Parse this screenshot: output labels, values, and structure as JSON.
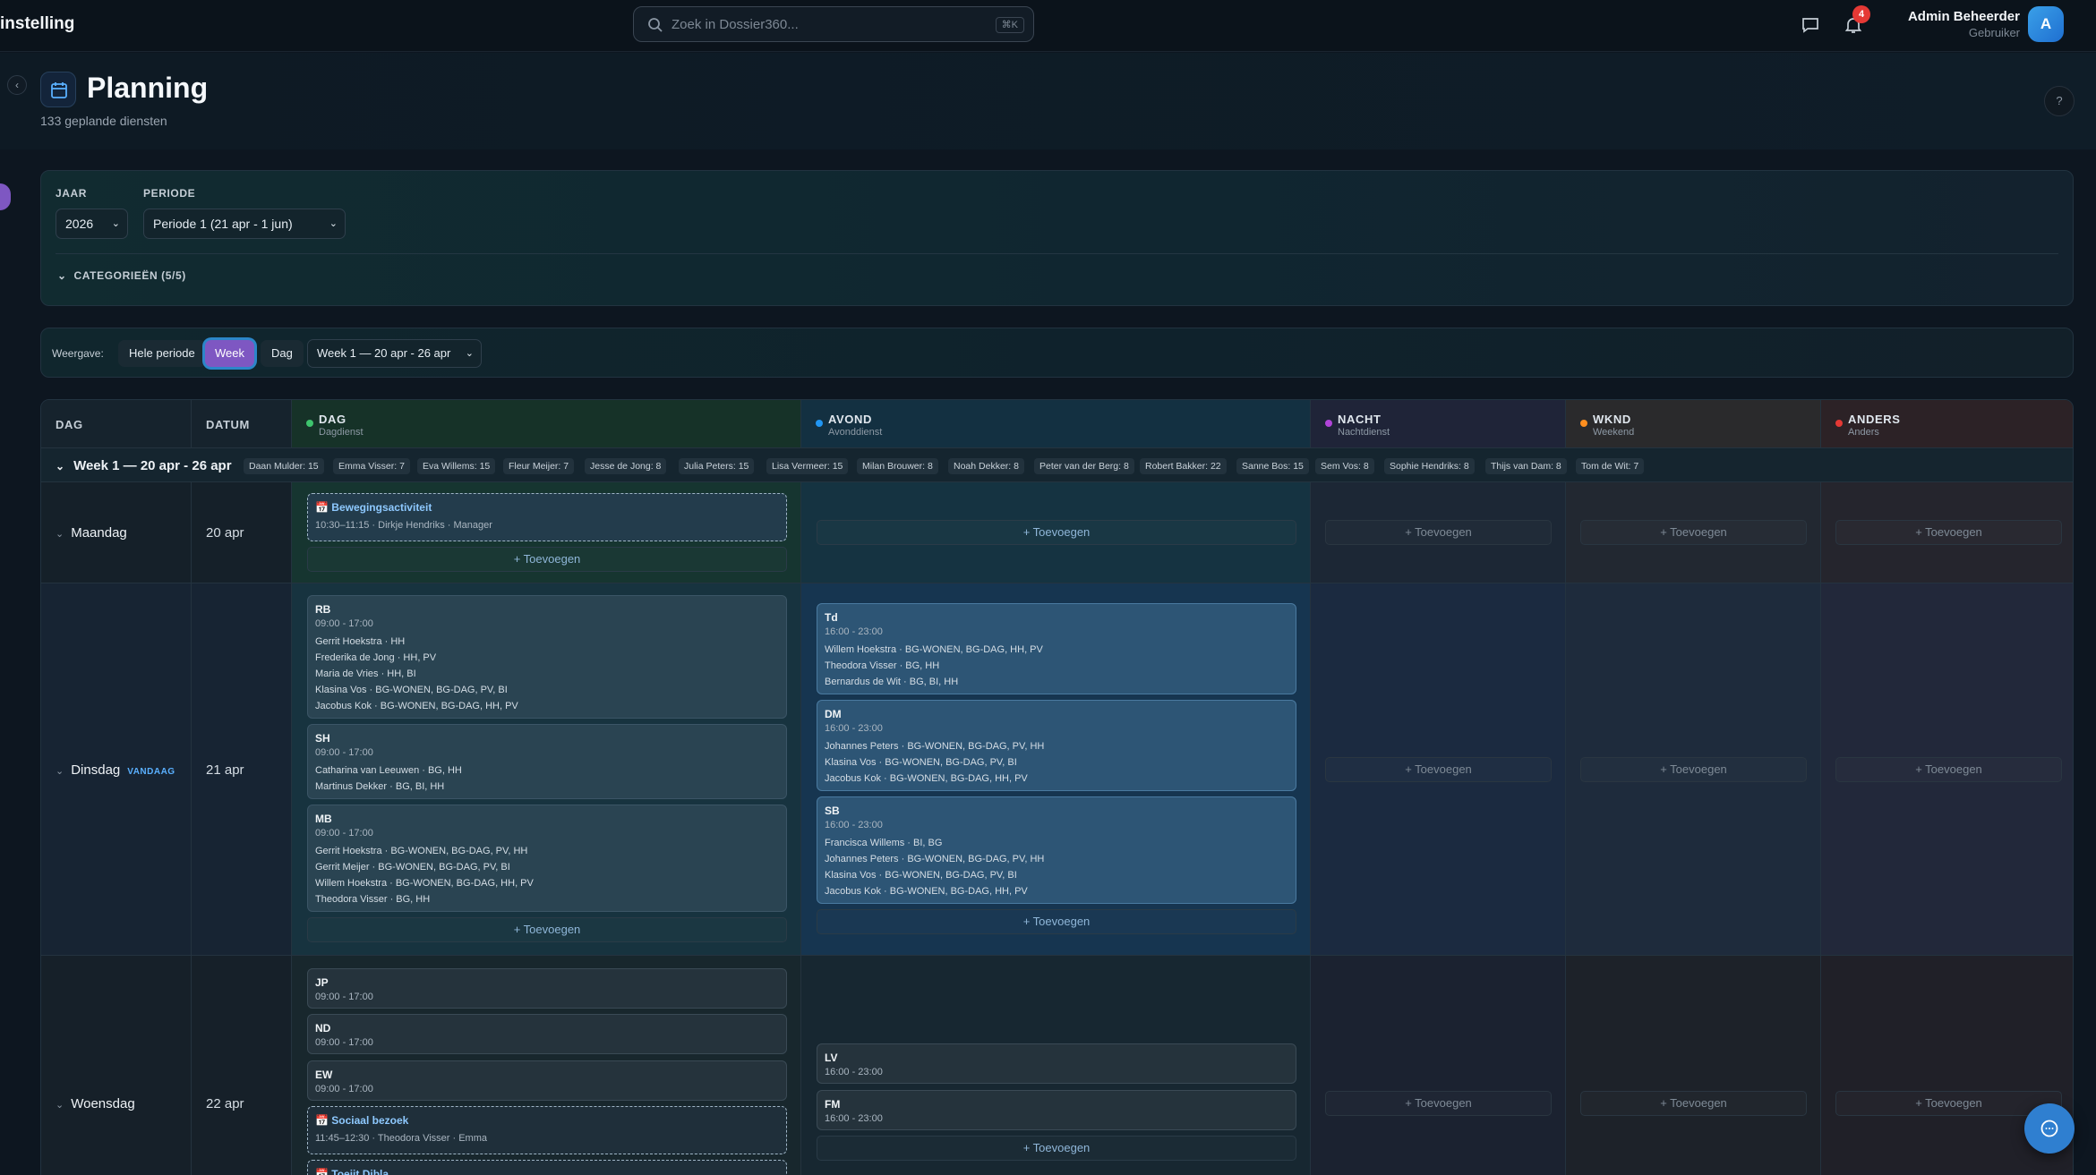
{
  "topbar": {
    "brand": "instelling",
    "search_placeholder": "Zoek in Dossier360...",
    "search_shortcut": "⌘K",
    "notification_count": "4",
    "user_name": "Admin Beheerder",
    "user_role": "Gebruiker",
    "avatar_initial": "A"
  },
  "header": {
    "title": "Planning",
    "subtitle": "133 geplande diensten",
    "help": "?"
  },
  "filters": {
    "year_label": "JAAR",
    "year_value": "2026",
    "period_label": "PERIODE",
    "period_value": "Periode 1 (21 apr - 1 jun)",
    "categories_label": "CATEGORIEËN (5/5)"
  },
  "view": {
    "label": "Weergave:",
    "options": [
      "Hele periode",
      "Week",
      "Dag"
    ],
    "active": "Week",
    "week_select": "Week 1 — 20 apr - 26 apr"
  },
  "grid": {
    "col_day": "DAG",
    "col_date": "DATUM",
    "shift_columns": [
      {
        "title": "DAG",
        "subtitle": "Dagdienst",
        "color": "#3ec46d"
      },
      {
        "title": "AVOND",
        "subtitle": "Avonddienst",
        "color": "#2196f3"
      },
      {
        "title": "NACHT",
        "subtitle": "Nachtdienst",
        "color": "#b044d8"
      },
      {
        "title": "WKND",
        "subtitle": "Weekend",
        "color": "#ff8f1f"
      },
      {
        "title": "ANDERS",
        "subtitle": "Anders",
        "color": "#e53935"
      }
    ],
    "week_title": "Week 1 — 20 apr - 26 apr",
    "chips": [
      "Daan Mulder: 15",
      "Emma Visser: 7",
      "Eva Willems: 15",
      "Fleur Meijer: 7",
      "Jesse de Jong: 8",
      "Julia Peters: 15",
      "Lisa Vermeer: 15",
      "Milan Brouwer: 8",
      "Noah Dekker: 8",
      "Peter van der Berg: 8",
      "Robert Bakker: 22",
      "Sanne Bos: 15",
      "Sem Vos: 8",
      "Sophie Hendriks: 8",
      "Thijs van Dam: 8",
      "Tom de Wit: 7"
    ],
    "add_label": "+ Toevoegen",
    "today_label": "VANDAAG",
    "days": [
      {
        "name": "Maandag",
        "date": "20 apr"
      },
      {
        "name": "Dinsdag",
        "date": "21 apr"
      },
      {
        "name": "Woensdag",
        "date": "22 apr"
      }
    ],
    "maandag_dag": {
      "activity": "Bewegingsactiviteit",
      "detail": "10:30–11:15 · Dirkje Hendriks · Manager"
    },
    "dinsdag_dag": [
      {
        "code": "RB",
        "time": "09:00 - 17:00",
        "people": [
          "Gerrit Hoekstra · HH",
          "Frederika de Jong · HH, PV",
          "Maria de Vries · HH, BI",
          "Klasina Vos · BG-WONEN, BG-DAG, PV, BI",
          "Jacobus Kok · BG-WONEN, BG-DAG, HH, PV"
        ]
      },
      {
        "code": "SH",
        "time": "09:00 - 17:00",
        "people": [
          "Catharina van Leeuwen · BG, HH",
          "Martinus Dekker · BG, BI, HH"
        ]
      },
      {
        "code": "MB",
        "time": "09:00 - 17:00",
        "people": [
          "Gerrit Hoekstra · BG-WONEN, BG-DAG, PV, HH",
          "Gerrit Meijer · BG-WONEN, BG-DAG, PV, BI",
          "Willem Hoekstra · BG-WONEN, BG-DAG, HH, PV",
          "Theodora Visser · BG, HH"
        ]
      }
    ],
    "dinsdag_avond": [
      {
        "code": "Td",
        "time": "16:00 - 23:00",
        "people": [
          "Willem Hoekstra · BG-WONEN, BG-DAG, HH, PV",
          "Theodora Visser · BG, HH",
          "Bernardus de Wit · BG, BI, HH"
        ]
      },
      {
        "code": "DM",
        "time": "16:00 - 23:00",
        "people": [
          "Johannes Peters · BG-WONEN, BG-DAG, PV, HH",
          "Klasina Vos · BG-WONEN, BG-DAG, PV, BI",
          "Jacobus Kok · BG-WONEN, BG-DAG, HH, PV"
        ]
      },
      {
        "code": "SB",
        "time": "16:00 - 23:00",
        "people": [
          "Francisca Willems · BI, BG",
          "Johannes Peters · BG-WONEN, BG-DAG, PV, HH",
          "Klasina Vos · BG-WONEN, BG-DAG, PV, BI",
          "Jacobus Kok · BG-WONEN, BG-DAG, HH, PV"
        ]
      }
    ],
    "woensdag_dag": [
      {
        "code": "JP",
        "time": "09:00 - 17:00"
      },
      {
        "code": "ND",
        "time": "09:00 - 17:00"
      },
      {
        "code": "EW",
        "time": "09:00 - 17:00"
      }
    ],
    "woensdag_activity": {
      "activity": "Sociaal bezoek",
      "detail": "11:45–12:30 · Theodora Visser · Emma"
    },
    "woensdag_activity2": "Toeiit Dibla",
    "woensdag_avond": [
      {
        "code": "LV",
        "time": "16:00 - 23:00"
      },
      {
        "code": "FM",
        "time": "16:00 - 23:00"
      }
    ]
  }
}
